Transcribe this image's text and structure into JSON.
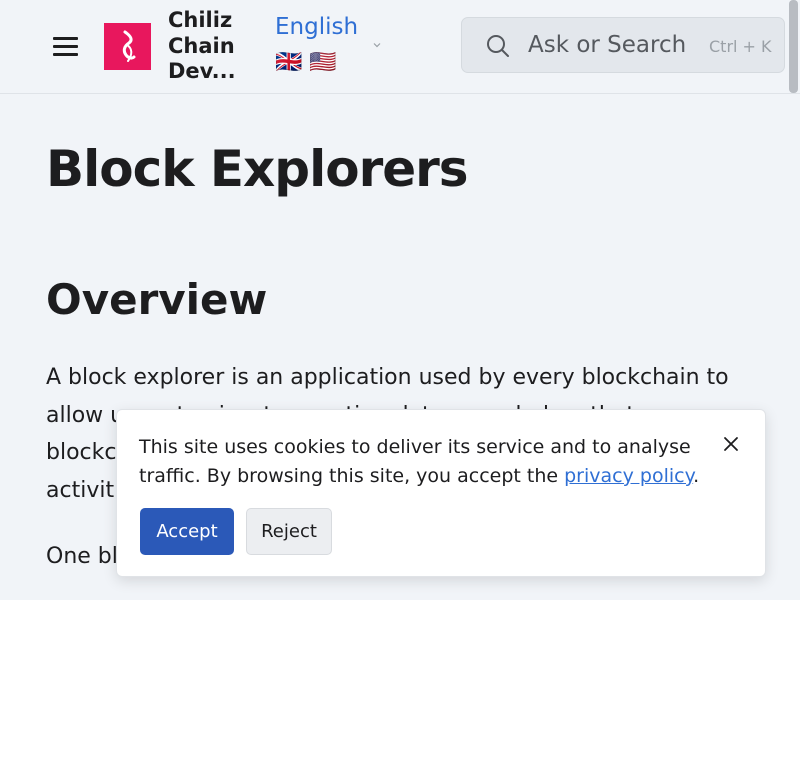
{
  "header": {
    "brand": "Chiliz Chain Dev...",
    "language": {
      "label": "English",
      "flags": "🇬🇧 🇺🇸"
    },
    "search": {
      "placeholder": "Ask or Search",
      "shortcut": "Ctrl + K"
    }
  },
  "main": {
    "page_title": "Block Explorers",
    "section_title": "Overview",
    "paragraph_1": "A block explorer is an application used by every blockchain to allow users to view transaction data recorded on that blockchain network, such as transactions, blocks, wallet activities and more.",
    "paragraph_2_visible": "One bl"
  },
  "cookie_banner": {
    "text": "This site uses cookies to deliver its service and to analyse traffic. By browsing this site, you accept the ",
    "link_text": "privacy policy",
    "text_end": ".",
    "accept_label": "Accept",
    "reject_label": "Reject"
  },
  "colors": {
    "accent": "#2f6fd4",
    "brand": "#e8175d",
    "accept_button": "#2b59b8",
    "page_background": "#f1f4f8"
  }
}
